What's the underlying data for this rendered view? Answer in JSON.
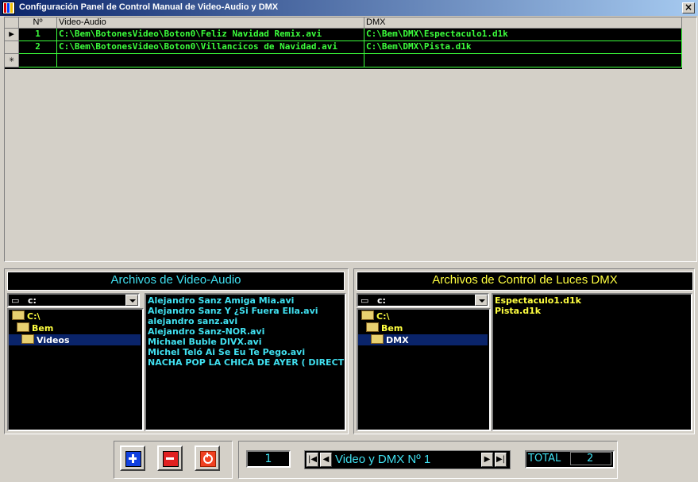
{
  "window": {
    "title": "Configuración Panel de Control Manual de Video-Audio y DMX",
    "close_label": "×"
  },
  "grid": {
    "columns": [
      "Nº",
      "Video-Audio",
      "DMX"
    ],
    "rows": [
      {
        "n": "1",
        "video": "C:\\Bem\\BotonesVideo\\Boton0\\Feliz Navidad  Remix.avi",
        "dmx": "C:\\Bem\\DMX\\Espectaculo1.d1k"
      },
      {
        "n": "2",
        "video": "C:\\Bem\\BotonesVideo\\Boton0\\Villancicos de Navidad.avi",
        "dmx": "C:\\Bem\\DMX\\Pista.d1k"
      }
    ],
    "current_row_marker": "▶",
    "new_row_marker": "✳"
  },
  "video_panel": {
    "title": "Archivos de Video-Audio",
    "drive": "c:",
    "tree": [
      "C:\\",
      "Bem",
      "Videos"
    ],
    "files": [
      "Alejandro Sanz  Amiga Mia.avi",
      "Alejandro Sanz  Y ¿Si Fuera Ella.avi",
      "alejandro sanz.avi",
      "Alejandro Sanz-NOR.avi",
      "Michael Buble DIVX.avi",
      "Michel Teló  Ai Se Eu Te Pego.avi",
      "NACHA POP  LA CHICA DE AYER ( DIRECT"
    ]
  },
  "dmx_panel": {
    "title": "Archivos de Control de Luces DMX",
    "drive": "c:",
    "tree": [
      "C:\\",
      "Bem",
      "DMX"
    ],
    "files": [
      "Espectaculo1.d1k",
      "Pista.d1k"
    ]
  },
  "toolbar": {
    "add_icon": "plus-icon",
    "remove_icon": "minus-icon",
    "power_icon": "power-icon"
  },
  "navigator": {
    "position": "1",
    "record_label": "Video y DMX Nº 1",
    "total_label": "TOTAL",
    "total_value": "2"
  },
  "colors": {
    "grid_text": "#3cff3c",
    "video_title": "#40e0f0",
    "dmx_title": "#ffff40",
    "video_files": "#40e0f0",
    "dmx_files": "#ffff40"
  }
}
